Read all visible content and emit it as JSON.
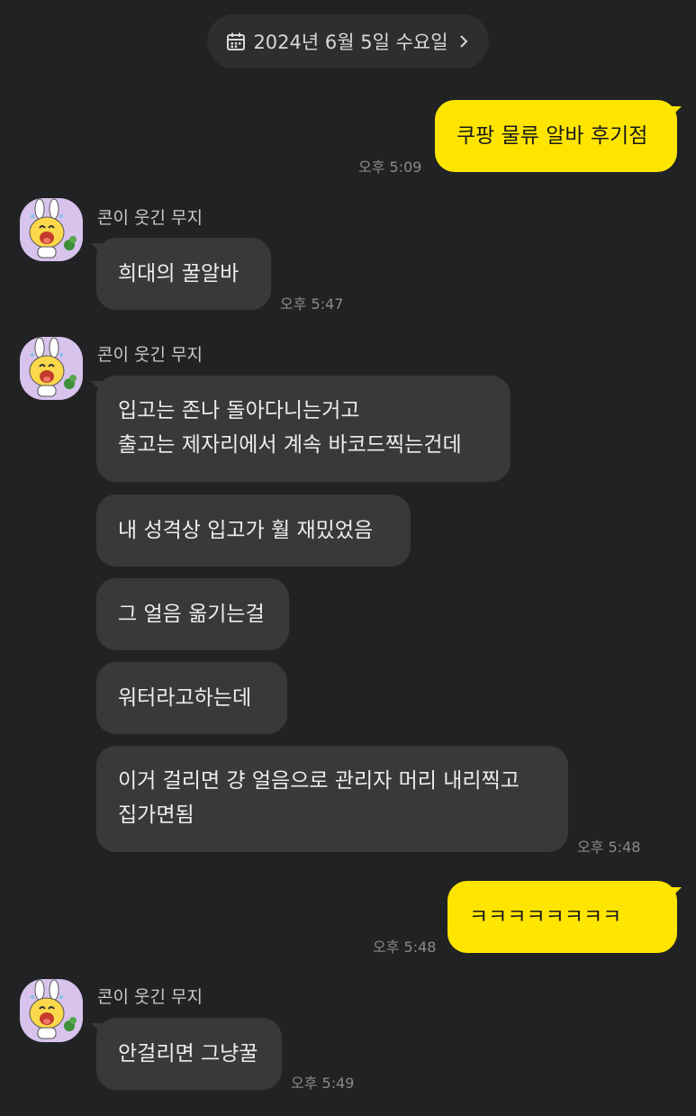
{
  "date_divider": {
    "label": "2024년 6월 5일 수요일",
    "icon": "calendar-icon",
    "chevron": "chevron-right-icon"
  },
  "colors": {
    "background": "#212224",
    "incoming_bubble": "#38393b",
    "outgoing_bubble": "#fee500",
    "timestamp": "#8a8b8d"
  },
  "messages": [
    {
      "direction": "out",
      "text": "쿠팡 물류 알바 후기점",
      "time": "오후 5:09"
    },
    {
      "direction": "in",
      "sender": "콘이 웃긴 무지",
      "text": "희대의 꿀알바",
      "time": "오후 5:47"
    },
    {
      "direction": "in",
      "sender": "콘이 웃긴 무지",
      "lines": [
        "입고는 존나 돌아다니는거고",
        "출고는 제자리에서 계속 바코드찍는건데"
      ]
    },
    {
      "direction": "in",
      "text": "내 성격상 입고가 훨 재밌었음"
    },
    {
      "direction": "in",
      "text": "그 얼음 옮기는걸"
    },
    {
      "direction": "in",
      "text": "워터라고하는데"
    },
    {
      "direction": "in",
      "lines": [
        "이거 걸리면 걍 얼음으로 관리자 머리 내리찍고",
        "집가면됨"
      ],
      "time": "오후 5:48"
    },
    {
      "direction": "out",
      "text": "ㅋㅋㅋㅋㅋㅋㅋㅋ",
      "time": "오후 5:48"
    },
    {
      "direction": "in",
      "sender": "콘이 웃긴 무지",
      "text": "안걸리면 그냥꿀",
      "time": "오후 5:49"
    }
  ]
}
